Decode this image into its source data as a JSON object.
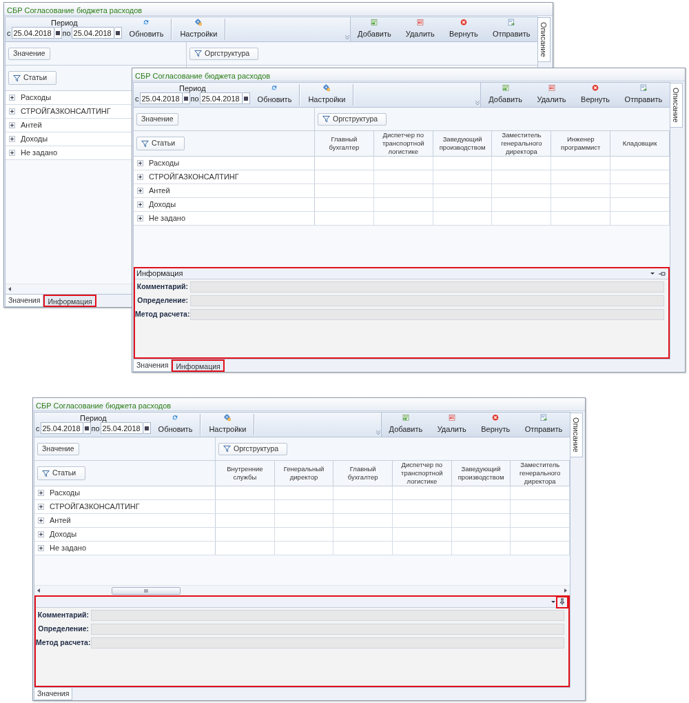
{
  "windows": [
    {
      "title": "СБР Согласование бюджета расходов",
      "side_tab": "Описание",
      "toolbar": {
        "period_label": "Период",
        "from_prefix": "с",
        "from_date": "25.04.2018",
        "to_prefix": "по",
        "to_date": "25.04.2018",
        "left_buttons": [
          {
            "label": "Обновить",
            "kind": "refresh"
          },
          {
            "label": "Настройки",
            "kind": "settings"
          }
        ],
        "right_buttons": [
          {
            "label": "Добавить",
            "kind": "add"
          },
          {
            "label": "Удалить",
            "kind": "delete"
          },
          {
            "label": "Вернуть",
            "kind": "revert"
          },
          {
            "label": "Отправить",
            "kind": "send"
          }
        ]
      },
      "value_button": "Значение",
      "org_button": "Оргструктура",
      "rows_button": "Статьи",
      "rows": [
        {
          "label": "Расходы",
          "expanded": false
        },
        {
          "label": "СТРОЙГАЗКОНСАЛТИНГ",
          "expanded": false
        },
        {
          "label": "Антей",
          "expanded": false
        },
        {
          "label": "Доходы",
          "expanded": false
        },
        {
          "label": "Не задано",
          "expanded": false
        }
      ],
      "scrollbar": {
        "thumb": false
      },
      "bottom_tabs": [
        {
          "label": "Значения",
          "selected": true,
          "highlighted": false
        },
        {
          "label": "Информация",
          "selected": false,
          "highlighted": true
        }
      ]
    },
    {
      "title": "СБР Согласование бюджета расходов",
      "side_tab": "Описание",
      "toolbar": {
        "period_label": "Период",
        "from_prefix": "с",
        "from_date": "25.04.2018",
        "to_prefix": "по",
        "to_date": "25.04.2018",
        "left_buttons": [
          {
            "label": "Обновить",
            "kind": "refresh"
          },
          {
            "label": "Настройки",
            "kind": "settings"
          }
        ],
        "right_buttons": [
          {
            "label": "Добавить",
            "kind": "add"
          },
          {
            "label": "Удалить",
            "kind": "delete"
          },
          {
            "label": "Вернуть",
            "kind": "revert"
          },
          {
            "label": "Отправить",
            "kind": "send"
          }
        ]
      },
      "value_button": "Значение",
      "org_button": "Оргструктура",
      "rows_button": "Статьи",
      "columns": [
        "Главный бухгалтер",
        "Диспетчер по транспортной логистике",
        "Заведующий производством",
        "Заместитель генерального директора",
        "Инженер программист",
        "Кладовщик"
      ],
      "rows": [
        {
          "label": "Расходы",
          "expanded": false
        },
        {
          "label": "СТРОЙГАЗКОНСАЛТИНГ",
          "expanded": false
        },
        {
          "label": "Антей",
          "expanded": false
        },
        {
          "label": "Доходы",
          "expanded": false
        },
        {
          "label": "Не задано",
          "expanded": false
        }
      ],
      "info_panel": {
        "title": "Информация",
        "highlighted": true,
        "pinned": false,
        "pin_highlighted": false,
        "fields": [
          {
            "label": "Комментарий:"
          },
          {
            "label": "Определение:"
          },
          {
            "label": "Метод расчета:"
          }
        ]
      },
      "bottom_tabs": [
        {
          "label": "Значения",
          "selected": true,
          "highlighted": false
        },
        {
          "label": "Информация",
          "selected": false,
          "highlighted": true
        }
      ]
    },
    {
      "title": "СБР Согласование бюджета расходов",
      "side_tab": "Описание",
      "toolbar": {
        "period_label": "Период",
        "from_prefix": "с",
        "from_date": "25.04.2018",
        "to_prefix": "по",
        "to_date": "25.04.2018",
        "left_buttons": [
          {
            "label": "Обновить",
            "kind": "refresh"
          },
          {
            "label": "Настройки",
            "kind": "settings"
          }
        ],
        "right_buttons": [
          {
            "label": "Добавить",
            "kind": "add"
          },
          {
            "label": "Удалить",
            "kind": "delete"
          },
          {
            "label": "Вернуть",
            "kind": "revert"
          },
          {
            "label": "Отправить",
            "kind": "send"
          }
        ]
      },
      "value_button": "Значение",
      "org_button": "Оргструктура",
      "rows_button": "Статьи",
      "columns": [
        "Внутренние службы",
        "Генеральный директор",
        "Главный бухгалтер",
        "Диспетчер по транспортной логистике",
        "Заведующий производством",
        "Заместитель генерального директора"
      ],
      "rows": [
        {
          "label": "Расходы",
          "expanded": false
        },
        {
          "label": "СТРОЙГАЗКОНСАЛТИНГ",
          "expanded": false
        },
        {
          "label": "Антей",
          "expanded": false
        },
        {
          "label": "Доходы",
          "expanded": false
        },
        {
          "label": "Не задано",
          "expanded": false
        }
      ],
      "scrollbar": {
        "thumb": true
      },
      "info_panel": {
        "highlighted": true,
        "pinned": true,
        "pin_highlighted": true,
        "fields": [
          {
            "label": "Комментарий:"
          },
          {
            "label": "Определение:"
          },
          {
            "label": "Метод расчета:"
          }
        ]
      },
      "bottom_tabs": [
        {
          "label": "Значения",
          "selected": true,
          "highlighted": false
        }
      ]
    }
  ]
}
